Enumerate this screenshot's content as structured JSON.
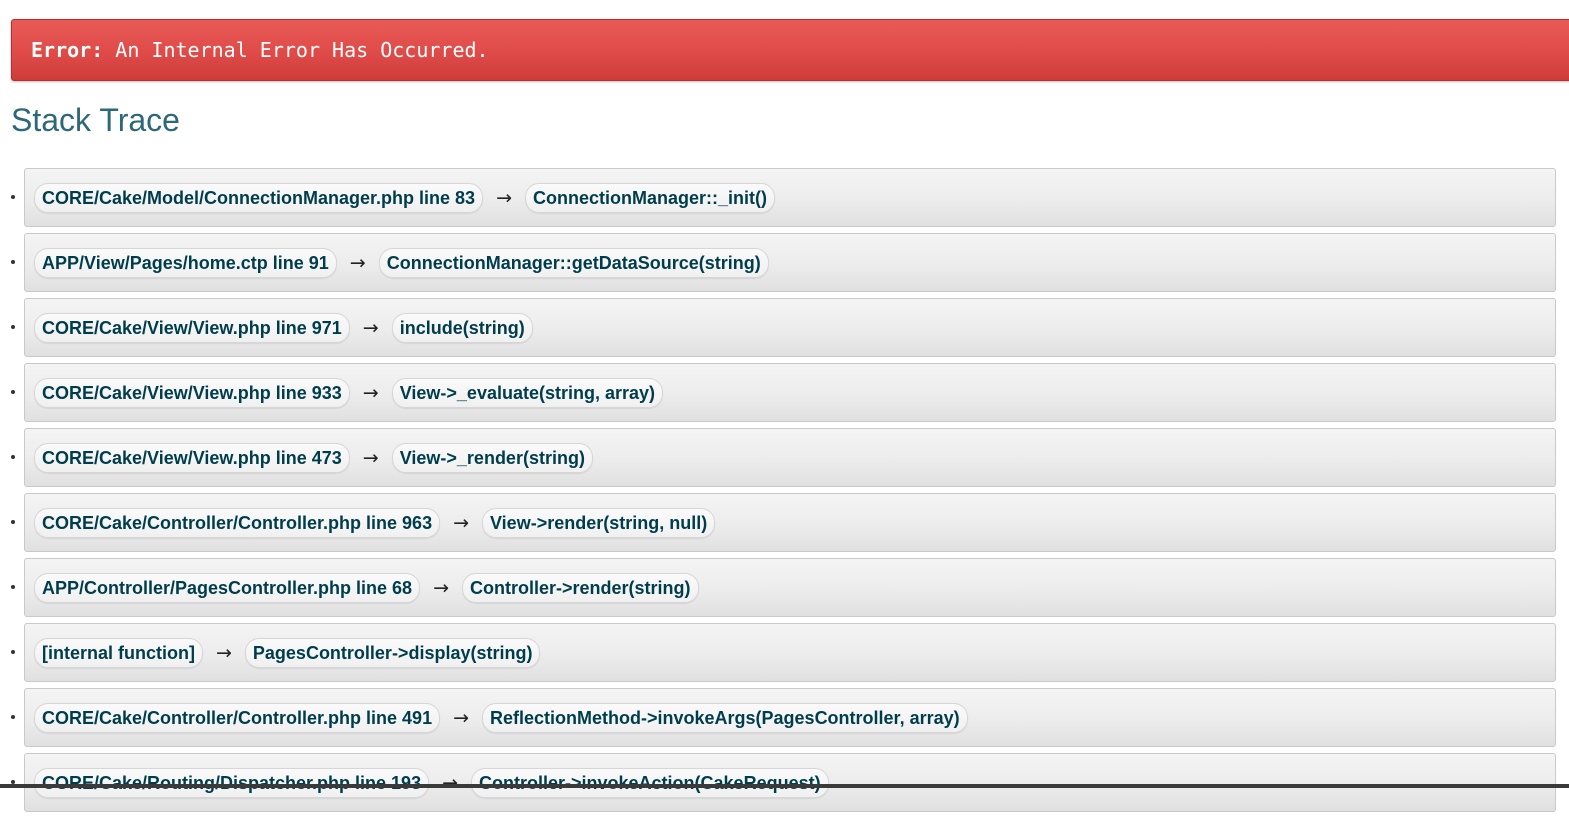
{
  "error": {
    "label": "Error:",
    "message": "An Internal Error Has Occurred."
  },
  "stack_trace": {
    "heading": "Stack Trace",
    "arrow": "→",
    "frames": [
      {
        "location": "CORE/Cake/Model/ConnectionManager.php line 83",
        "call": "ConnectionManager::_init()"
      },
      {
        "location": "APP/View/Pages/home.ctp line 91",
        "call": "ConnectionManager::getDataSource(string)"
      },
      {
        "location": "CORE/Cake/View/View.php line 971",
        "call": "include(string)"
      },
      {
        "location": "CORE/Cake/View/View.php line 933",
        "call": "View->_evaluate(string, array)"
      },
      {
        "location": "CORE/Cake/View/View.php line 473",
        "call": "View->_render(string)"
      },
      {
        "location": "CORE/Cake/Controller/Controller.php line 963",
        "call": "View->render(string, null)"
      },
      {
        "location": "APP/Controller/PagesController.php line 68",
        "call": "Controller->render(string)"
      },
      {
        "location": "[internal function]",
        "call": "PagesController->display(string)"
      },
      {
        "location": "CORE/Cake/Controller/Controller.php line 491",
        "call": "ReflectionMethod->invokeArgs(PagesController, array)"
      },
      {
        "location": "CORE/Cake/Routing/Dispatcher.php line 193",
        "call": "Controller->invokeAction(CakeRequest)"
      }
    ]
  },
  "colors": {
    "error_banner": "#df4b48",
    "heading": "#2c6877",
    "frame_text": "#003d4c"
  }
}
